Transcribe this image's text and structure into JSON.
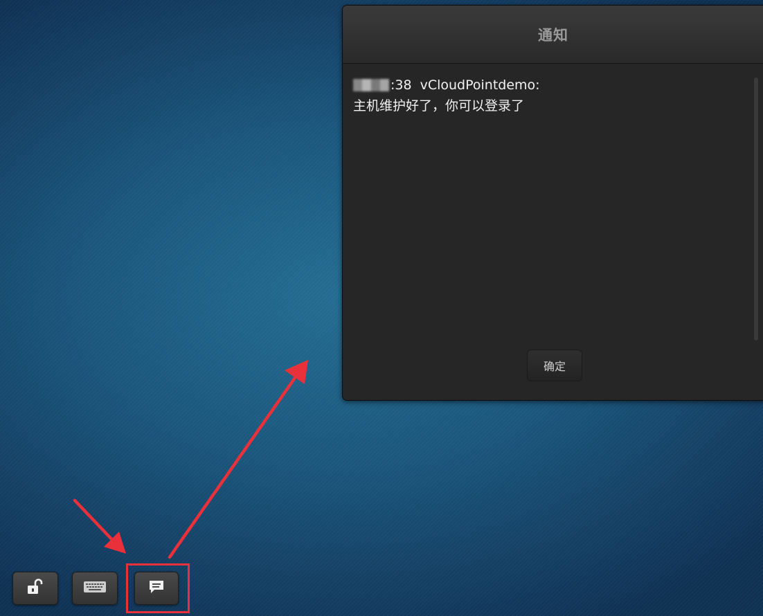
{
  "notification": {
    "title": "通知",
    "time_suffix": ":38",
    "sender": "vCloudPointdemo:",
    "message": "主机维护好了，你可以登录了",
    "ok_label": "确定"
  },
  "toolbar": {
    "buttons": [
      {
        "name": "unlock",
        "icon": "unlock-icon"
      },
      {
        "name": "keyboard",
        "icon": "keyboard-icon"
      },
      {
        "name": "message",
        "icon": "chat-icon"
      }
    ]
  },
  "colors": {
    "annotation_red": "#e8313a",
    "dialog_bg": "#262626",
    "desktop_blue": "#1b577d"
  }
}
